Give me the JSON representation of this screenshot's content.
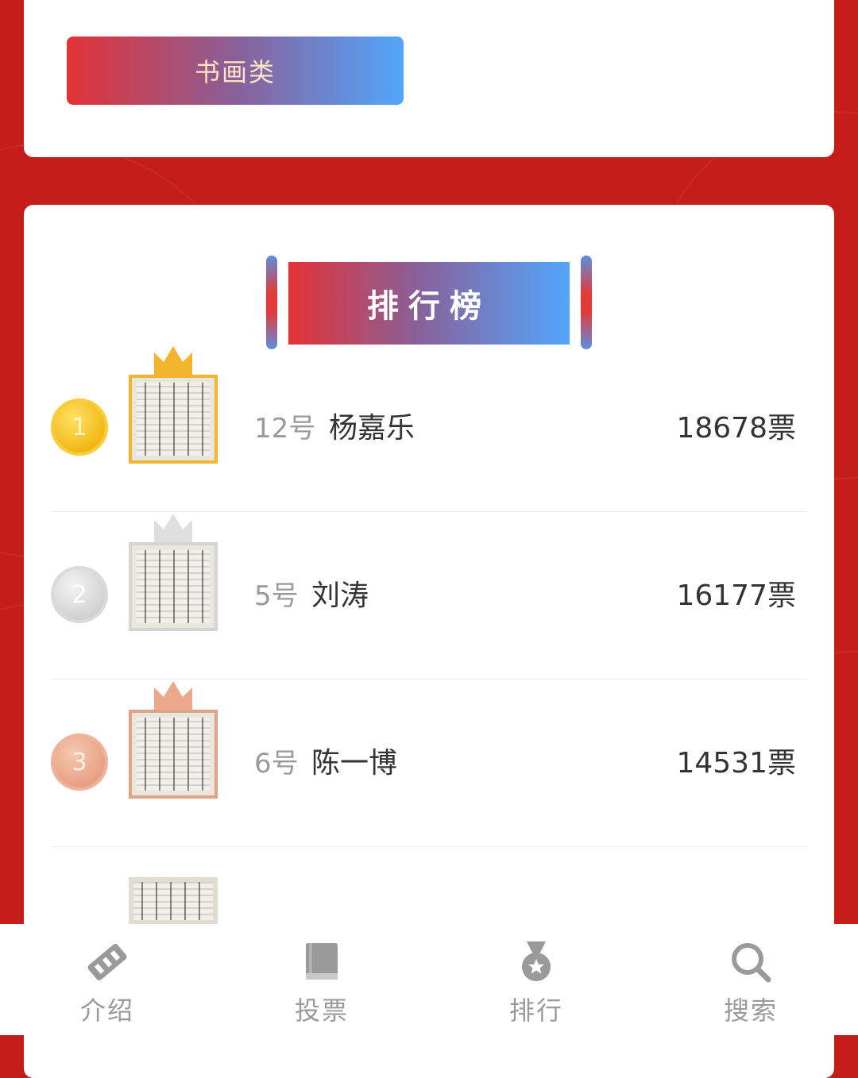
{
  "category": {
    "label": "书画类"
  },
  "ranking": {
    "title": "排行榜",
    "entries": [
      {
        "rank": "1",
        "number": "12号",
        "name": "杨嘉乐",
        "votes": "18678票",
        "tier": "gold"
      },
      {
        "rank": "2",
        "number": "5号",
        "name": "刘涛",
        "votes": "16177票",
        "tier": "silver"
      },
      {
        "rank": "3",
        "number": "6号",
        "name": "陈一博",
        "votes": "14531票",
        "tier": "bronze"
      }
    ]
  },
  "tabbar": {
    "items": [
      {
        "label": "介绍",
        "icon": "ticket-icon"
      },
      {
        "label": "投票",
        "icon": "book-icon"
      },
      {
        "label": "排行",
        "icon": "medal-icon"
      },
      {
        "label": "搜索",
        "icon": "search-icon"
      }
    ]
  },
  "colors": {
    "background": "#c41d1a",
    "gradient_start": "#e43236",
    "gradient_end": "#52a6fc",
    "gold": "#f2b52d",
    "silver": "#d4d4d4",
    "bronze": "#e0a386"
  }
}
